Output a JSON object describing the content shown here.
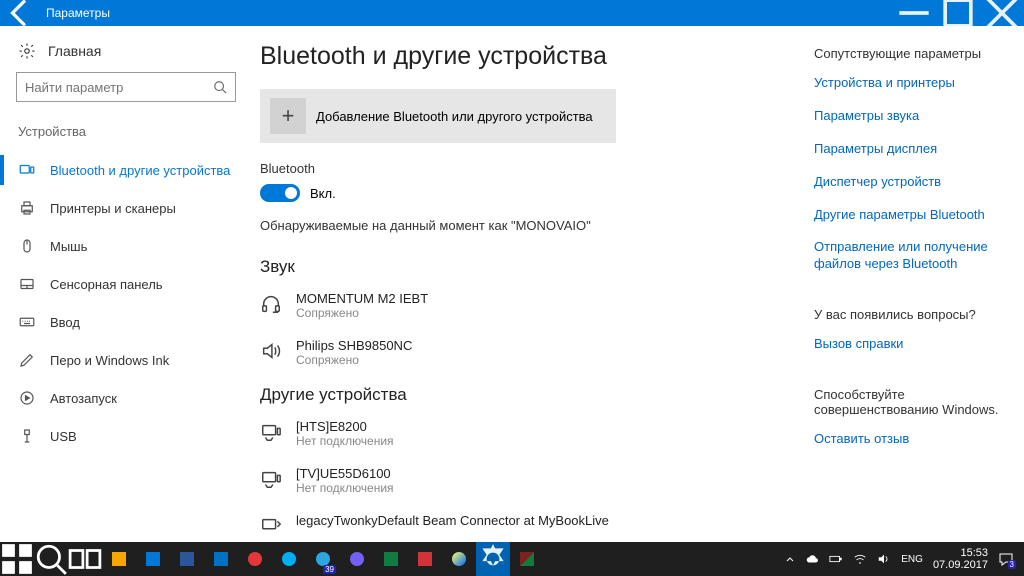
{
  "titlebar": {
    "title": "Параметры"
  },
  "sidebar": {
    "home": "Главная",
    "search_placeholder": "Найти параметр",
    "category": "Устройства",
    "items": [
      {
        "label": "Bluetooth и другие устройства"
      },
      {
        "label": "Принтеры и сканеры"
      },
      {
        "label": "Мышь"
      },
      {
        "label": "Сенсорная панель"
      },
      {
        "label": "Ввод"
      },
      {
        "label": "Перо и Windows Ink"
      },
      {
        "label": "Автозапуск"
      },
      {
        "label": "USB"
      }
    ]
  },
  "main": {
    "heading": "Bluetooth и другие устройства",
    "add_label": "Добавление Bluetooth или другого устройства",
    "bt_label": "Bluetooth",
    "bt_state": "Вкл.",
    "discoverable": "Обнаруживаемые на данный момент как \"MONOVAIO\"",
    "sound_heading": "Звук",
    "sound_devices": [
      {
        "name": "MOMENTUM M2 IEBT",
        "status": "Сопряжено"
      },
      {
        "name": "Philips SHB9850NC",
        "status": "Сопряжено"
      }
    ],
    "other_heading": "Другие устройства",
    "other_devices": [
      {
        "name": "[HTS]E8200",
        "status": "Нет подключения"
      },
      {
        "name": "[TV]UE55D6100",
        "status": "Нет подключения"
      },
      {
        "name": "legacyTwonkyDefault Beam Connector at MyBookLive",
        "status": ""
      }
    ]
  },
  "aside": {
    "related_h": "Сопутствующие параметры",
    "links1": [
      "Устройства и принтеры",
      "Параметры звука",
      "Параметры дисплея",
      "Диспетчер устройств",
      "Другие параметры Bluetooth",
      "Отправление или получение файлов через Bluetooth"
    ],
    "q_h": "У вас появились вопросы?",
    "help": "Вызов справки",
    "fb_h": "Способствуйте совершенствованию Windows.",
    "fb": "Оставить отзыв"
  },
  "taskbar": {
    "lang": "ENG",
    "time": "15:53",
    "date": "07.09.2017",
    "notif": "3"
  }
}
